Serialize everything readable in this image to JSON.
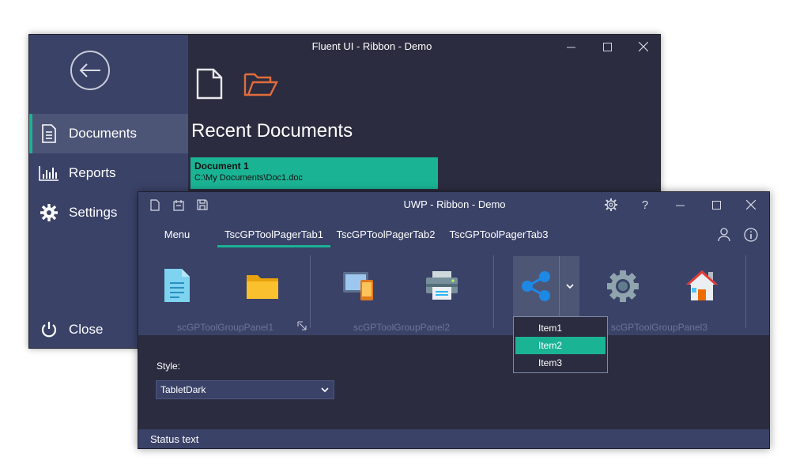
{
  "fluent": {
    "title": "Fluent UI - Ribbon - Demo",
    "nav": [
      {
        "label": "Documents",
        "icon": "document-icon",
        "active": true
      },
      {
        "label": "Reports",
        "icon": "bar-chart-icon"
      },
      {
        "label": "Settings",
        "icon": "gear-icon"
      }
    ],
    "close_label": "Close",
    "recent_title": "Recent Documents",
    "recent_docs": [
      {
        "name": "Document 1",
        "path": "C:\\My Documents\\Doc1.doc"
      }
    ]
  },
  "uwp": {
    "title": "UWP - Ribbon - Demo",
    "tabs": [
      {
        "label": "Menu"
      },
      {
        "label": "TscGPToolPagerTab1",
        "active": true
      },
      {
        "label": "TscGPToolPagerTab2"
      },
      {
        "label": "TscGPToolPagerTab3"
      }
    ],
    "groups": [
      {
        "label": "scGPToolGroupPanel1"
      },
      {
        "label": "scGPToolGroupPanel2"
      },
      {
        "label": "scGPToolGroupPanel3"
      }
    ],
    "dropdown_items": [
      "Item1",
      "Item2",
      "Item3"
    ],
    "dropdown_selected": "Item2",
    "style_label": "Style:",
    "style_value": "TabletDark",
    "status_text": "Status text"
  },
  "colors": {
    "accent": "#1ab394",
    "panel": "#3a4268",
    "background": "#2b2c3f"
  }
}
